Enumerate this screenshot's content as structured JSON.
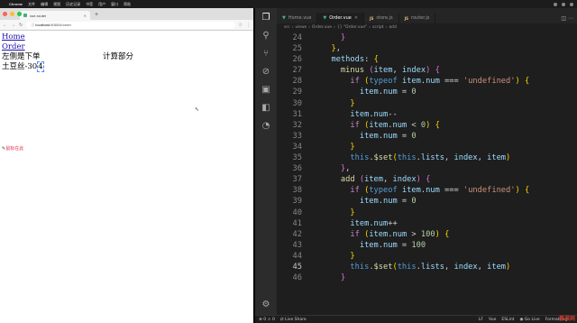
{
  "menubar": {
    "app": "Chrome",
    "items": [
      "文件",
      "编辑",
      "视图",
      "历史记录",
      "书签",
      "用户",
      "窗口",
      "帮助"
    ]
  },
  "browser": {
    "tab_title": "vue-router",
    "new_tab": "+",
    "url_host": "localhost",
    "url_path": ":8080/#/order",
    "links": {
      "home": "Home",
      "order": "Order"
    },
    "left_heading": "左侧是下单",
    "right_heading": "计算部分",
    "item_name": "土豆丝",
    "item_price": "-30",
    "item_num": "4",
    "stray_text": "鼠标在此"
  },
  "editor": {
    "tabs": [
      {
        "label": "Home.vue",
        "icon": "vue-icon",
        "active": false
      },
      {
        "label": "Order.vue",
        "icon": "vue-icon",
        "active": true
      },
      {
        "label": "store.js",
        "icon": "js-icon",
        "active": false
      },
      {
        "label": "router.js",
        "icon": "js-icon",
        "active": false
      }
    ],
    "breadcrumb": [
      "src",
      "views",
      "Order.vue",
      "{} \"Order.vue\"",
      "script",
      "add"
    ],
    "line_numbers": [
      "24",
      "25",
      "26",
      "27",
      "28",
      "29",
      "30",
      "31",
      "32",
      "33",
      "34",
      "35",
      "36",
      "37",
      "38",
      "39",
      "40",
      "41",
      "42",
      "43",
      "44",
      "45",
      "46"
    ],
    "current_line": "45",
    "status": {
      "errors": "0",
      "warnings": "0",
      "live_share": "Live Share",
      "eol": "LF",
      "lang": "Vue",
      "eslint": "ESLint",
      "golive": "Go Live",
      "formatting": "Formatting: ✓"
    }
  },
  "watermark": "慕课网"
}
